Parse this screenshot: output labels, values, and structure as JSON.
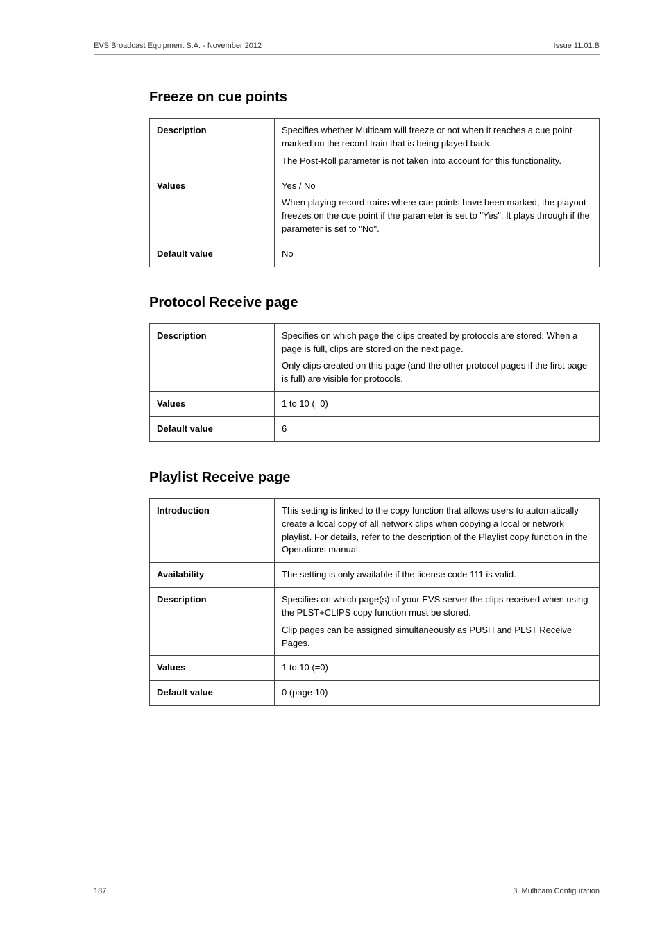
{
  "header": {
    "left": "EVS Broadcast Equipment S.A.  -  November 2012",
    "right": "Issue 11.01.B"
  },
  "sections": [
    {
      "title": "Freeze on cue points",
      "rows": [
        {
          "key": "Description",
          "paras": [
            "Specifies whether Multicam will freeze or not when it reaches a cue point marked on the record train that is being played back.",
            "The Post-Roll parameter is not taken into account for this functionality."
          ]
        },
        {
          "key": "Values",
          "paras": [
            "Yes / No",
            "When playing record trains where cue points have been marked, the playout freezes on the cue point if the parameter is set to \"Yes\". It plays through if the parameter is set to \"No\"."
          ]
        },
        {
          "key": "Default value",
          "paras": [
            "No"
          ]
        }
      ]
    },
    {
      "title": "Protocol Receive page",
      "rows": [
        {
          "key": "Description",
          "paras": [
            "Specifies on which page the clips created by protocols are stored. When a page is full, clips are stored on the next page.",
            "Only clips created on this page (and the other protocol pages if the first page is full) are visible for protocols."
          ]
        },
        {
          "key": "Values",
          "paras": [
            "1 to 10 (=0)"
          ]
        },
        {
          "key": "Default value",
          "paras": [
            "6"
          ]
        }
      ]
    },
    {
      "title": "Playlist Receive page",
      "rows": [
        {
          "key": "Introduction",
          "paras": [
            "This setting is linked to the copy function that allows users to automatically create a local copy of all network clips when copying a local or network playlist. For details, refer to the description of the Playlist copy function in the Operations manual."
          ]
        },
        {
          "key": "Availability",
          "paras": [
            "The setting is only available if the license code 111 is valid."
          ]
        },
        {
          "key": "Description",
          "paras": [
            "Specifies on which page(s) of your EVS server the clips received when using the PLST+CLIPS copy function must be stored.",
            "Clip pages can be assigned simultaneously as PUSH and PLST Receive Pages."
          ]
        },
        {
          "key": "Values",
          "paras": [
            "1 to 10 (=0)"
          ]
        },
        {
          "key": "Default value",
          "paras": [
            "0 (page 10)"
          ]
        }
      ]
    }
  ],
  "footer": {
    "left": "187",
    "right": "3. Multicam Configuration"
  }
}
